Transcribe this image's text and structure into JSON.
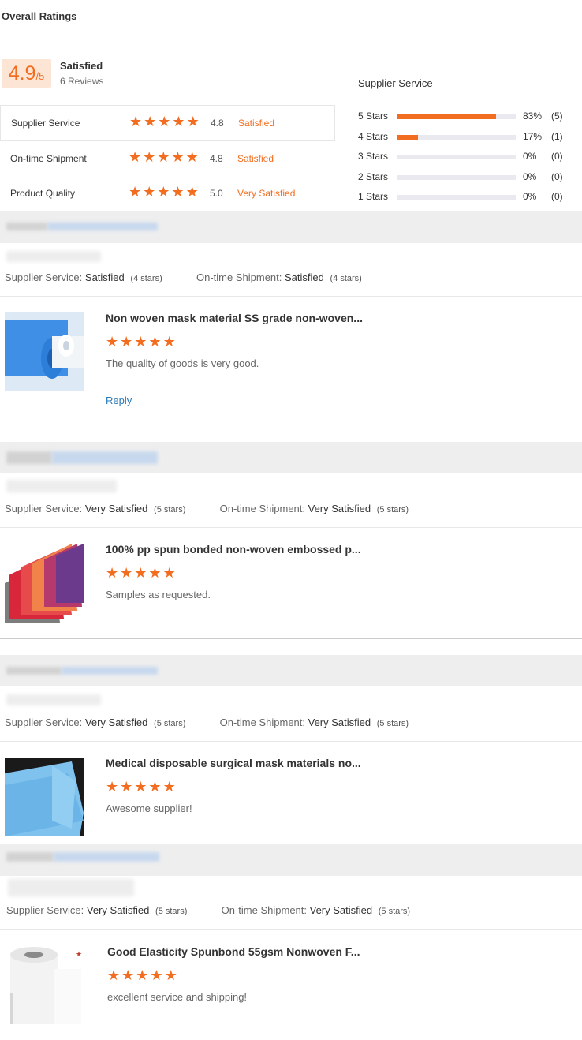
{
  "page": {
    "title": "Overall Ratings"
  },
  "overall": {
    "score": "4.9",
    "score_denominator": "/5",
    "label": "Satisfied",
    "reviews_count": "6 Reviews",
    "categories": [
      {
        "name": "Supplier Service",
        "stars": 5,
        "score": "4.8",
        "level": "Satisfied"
      },
      {
        "name": "On-time Shipment",
        "stars": 5,
        "score": "4.8",
        "level": "Satisfied"
      },
      {
        "name": "Product Quality",
        "stars": 5,
        "score": "5.0",
        "level": "Very Satisfied"
      }
    ]
  },
  "breakdown": {
    "title": "Supplier Service",
    "accent_color": "#f26d1f",
    "rows": [
      {
        "label": "5 Stars",
        "fraction": 0.83,
        "pct": "83%",
        "count": "(5)"
      },
      {
        "label": "4 Stars",
        "fraction": 0.17,
        "pct": "17%",
        "count": "(1)"
      },
      {
        "label": "3 Stars",
        "fraction": 0,
        "pct": "0%",
        "count": "(0)"
      },
      {
        "label": "2 Stars",
        "fraction": 0,
        "pct": "0%",
        "count": "(0)"
      },
      {
        "label": "1 Stars",
        "fraction": 0,
        "pct": "0%",
        "count": "(0)"
      }
    ]
  },
  "reviews": [
    {
      "service_label": "Supplier Service:",
      "service_value": "Satisfied",
      "service_stars": "(4 stars)",
      "shipment_label": "On-time Shipment:",
      "shipment_value": "Satisfied",
      "shipment_stars": "(4 stars)",
      "product_title": "Non woven mask material SS grade non-woven...",
      "rating": 5,
      "comment": "The quality of goods is very good.",
      "reply_label": "Reply",
      "thumb_icon": "blue-fabric-roll-image"
    },
    {
      "service_label": "Supplier Service:",
      "service_value": "Very Satisfied",
      "service_stars": "(5 stars)",
      "shipment_label": "On-time Shipment:",
      "shipment_value": "Very Satisfied",
      "shipment_stars": "(5 stars)",
      "product_title": "100% pp spun bonded non-woven embossed p...",
      "rating": 5,
      "comment": "Samples as requested.",
      "thumb_icon": "colored-fabric-sheets-image"
    },
    {
      "service_label": "Supplier Service:",
      "service_value": "Very Satisfied",
      "service_stars": "(5 stars)",
      "shipment_label": "On-time Shipment:",
      "shipment_value": "Very Satisfied",
      "shipment_stars": "(5 stars)",
      "product_title": "Medical disposable surgical mask materials no...",
      "rating": 5,
      "comment": "Awesome supplier!",
      "thumb_icon": "blue-fabric-sheet-image"
    },
    {
      "service_label": "Supplier Service:",
      "service_value": "Very Satisfied",
      "service_stars": "(5 stars)",
      "shipment_label": "On-time Shipment:",
      "shipment_value": "Very Satisfied",
      "shipment_stars": "(5 stars)",
      "product_title": "Good Elasticity Spunbond 55gsm Nonwoven F...",
      "rating": 5,
      "comment": "excellent service and shipping!",
      "thumb_icon": "white-fabric-roll-image"
    }
  ]
}
